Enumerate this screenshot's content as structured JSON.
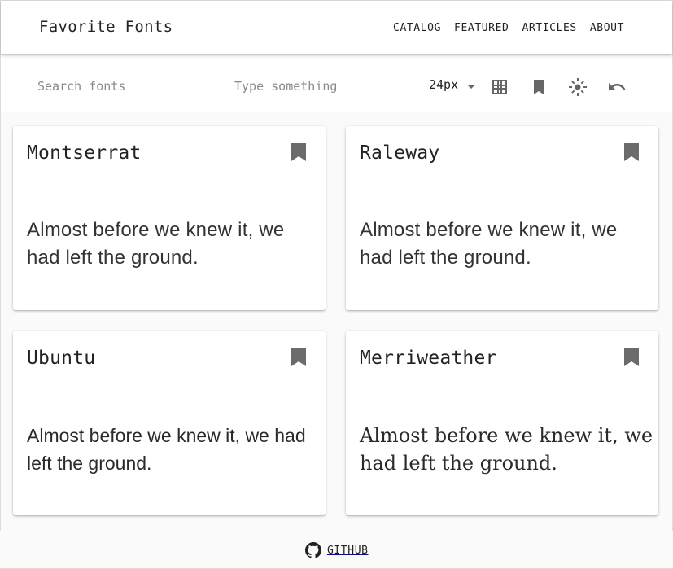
{
  "header": {
    "brand": "Favorite Fonts",
    "nav": [
      "CATALOG",
      "FEATURED",
      "ARTICLES",
      "ABOUT"
    ]
  },
  "toolbar": {
    "search_placeholder": "Search fonts",
    "preview_placeholder": "Type something",
    "font_size": "24px",
    "icons": [
      "grid-view-icon",
      "bookmark-icon",
      "brightness-icon",
      "undo-icon"
    ]
  },
  "cards": [
    {
      "name": "Montserrat",
      "sample": "Almost before we knew it, we had left the ground."
    },
    {
      "name": "Raleway",
      "sample": "Almost before we knew it, we had left the ground."
    },
    {
      "name": "Ubuntu",
      "sample": "Almost before we knew it, we had left the ground."
    },
    {
      "name": "Merriweather",
      "sample": "Almost before we knew it, we had left the ground."
    }
  ],
  "footer": {
    "link": "GITHUB"
  },
  "colors": {
    "icon": "#666666",
    "text": "#222222",
    "background": "#fafafa"
  }
}
